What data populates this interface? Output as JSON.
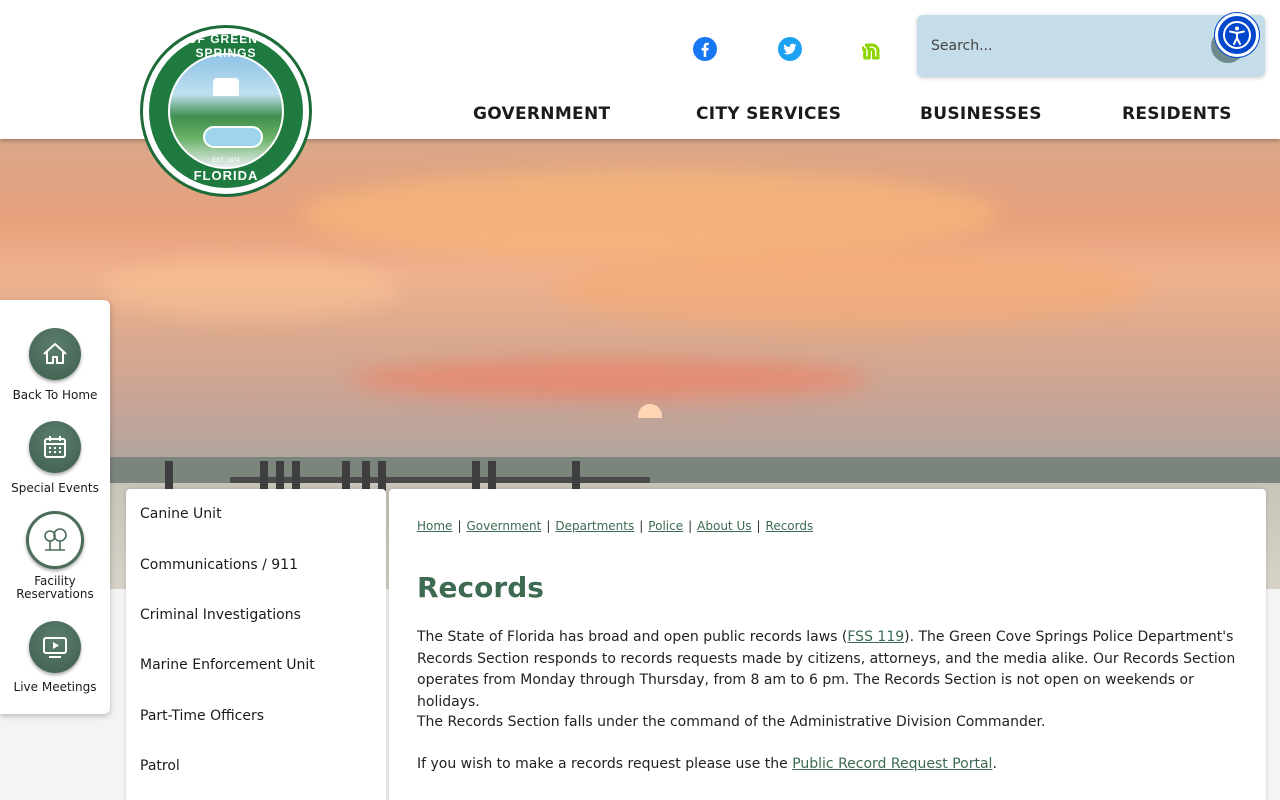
{
  "site": {
    "seal_top_text": "CITY OF GREEN COVE SPRINGS",
    "seal_bottom_text": "FLORIDA",
    "seal_est_text": "EST. 1874"
  },
  "header": {
    "social": [
      {
        "name": "facebook-icon",
        "color": "#1877f2"
      },
      {
        "name": "twitter-icon",
        "color": "#1da1f2"
      },
      {
        "name": "nextdoor-icon",
        "color": "#8ed500"
      }
    ],
    "search_placeholder": "Search...",
    "nav": [
      "GOVERNMENT",
      "CITY SERVICES",
      "BUSINESSES",
      "RESIDENTS"
    ]
  },
  "quick_links": [
    {
      "label": "Back To Home",
      "icon": "home-icon"
    },
    {
      "label": "Special Events",
      "icon": "calendar-icon"
    },
    {
      "label": "Facility Reservations",
      "icon": "trees-icon"
    },
    {
      "label": "Live Meetings",
      "icon": "video-icon"
    }
  ],
  "sidenav": {
    "items": [
      "Canine Unit",
      "Communications / 911",
      "Criminal Investigations",
      "Marine Enforcement Unit",
      "Part-Time Officers",
      "Patrol"
    ]
  },
  "breadcrumb": [
    "Home",
    "Government",
    "Departments",
    "Police",
    "About Us",
    "Records"
  ],
  "page": {
    "title": "Records",
    "p1_before": "The State of Florida has broad and open public records laws (",
    "p1_link": "FSS 119",
    "p1_after": "). The Green Cove Springs Police Department's Records Section responds to records requests made by citizens, attorneys, and the media alike. Our Records Section operates from Monday through Thursday, from 8 am to 6 pm. The Records Section is not open on weekends or holidays.",
    "p2": "The Records Section falls under the command of the Administrative Division Commander.",
    "p3_before": "If you wish to make a records request please use the ",
    "p3_link": "Public Record Request Portal",
    "p3_after": "."
  },
  "colors": {
    "accent_green": "#3d6b52",
    "search_bg": "#c5dde9",
    "accessibility_blue": "#0047cc"
  }
}
